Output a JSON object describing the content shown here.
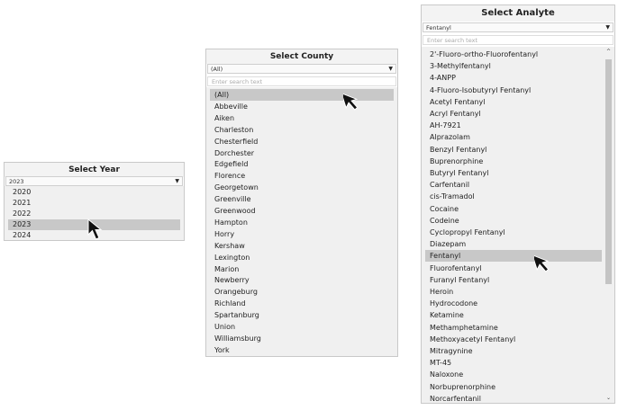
{
  "year_filter": {
    "title": "Select Year",
    "selected": "2023",
    "options": [
      "2020",
      "2021",
      "2022",
      "2023",
      "2024"
    ],
    "highlighted_index": 3
  },
  "county_filter": {
    "title": "Select County",
    "selected": "(All)",
    "search_placeholder": "Enter search text",
    "options": [
      "(All)",
      "Abbeville",
      "Aiken",
      "Charleston",
      "Chesterfield",
      "Dorchester",
      "Edgefield",
      "Florence",
      "Georgetown",
      "Greenville",
      "Greenwood",
      "Hampton",
      "Horry",
      "Kershaw",
      "Lexington",
      "Marion",
      "Newberry",
      "Orangeburg",
      "Richland",
      "Spartanburg",
      "Union",
      "Williamsburg",
      "York"
    ],
    "highlighted_index": 0
  },
  "analyte_filter": {
    "title": "Select Analyte",
    "selected": "Fentanyl",
    "search_placeholder": "Enter search text",
    "options": [
      "2'-Fluoro-ortho-Fluorofentanyl",
      "3-Methylfentanyl",
      "4-ANPP",
      "4-Fluoro-Isobutyryl Fentanyl",
      "Acetyl Fentanyl",
      "Acryl Fentanyl",
      "AH-7921",
      "Alprazolam",
      "Benzyl Fentanyl",
      "Buprenorphine",
      "Butyryl Fentanyl",
      "Carfentanil",
      "cis-Tramadol",
      "Cocaine",
      "Codeine",
      "Cyclopropyl Fentanyl",
      "Diazepam",
      "Fentanyl",
      "Fluorofentanyl",
      "Furanyl Fentanyl",
      "Heroin",
      "Hydrocodone",
      "Ketamine",
      "Methamphetamine",
      "Methoxyacetyl Fentanyl",
      "Mitragynine",
      "MT-45",
      "Naloxone",
      "Norbuprenorphine",
      "Norcarfentanil"
    ],
    "highlighted_index": 17
  },
  "icons": {
    "dropdown": "caret-down-icon",
    "cursor": "mouse-pointer-icon",
    "scroll_up": "scroll-up-arrow-icon",
    "scroll_down": "scroll-down-arrow-icon"
  }
}
